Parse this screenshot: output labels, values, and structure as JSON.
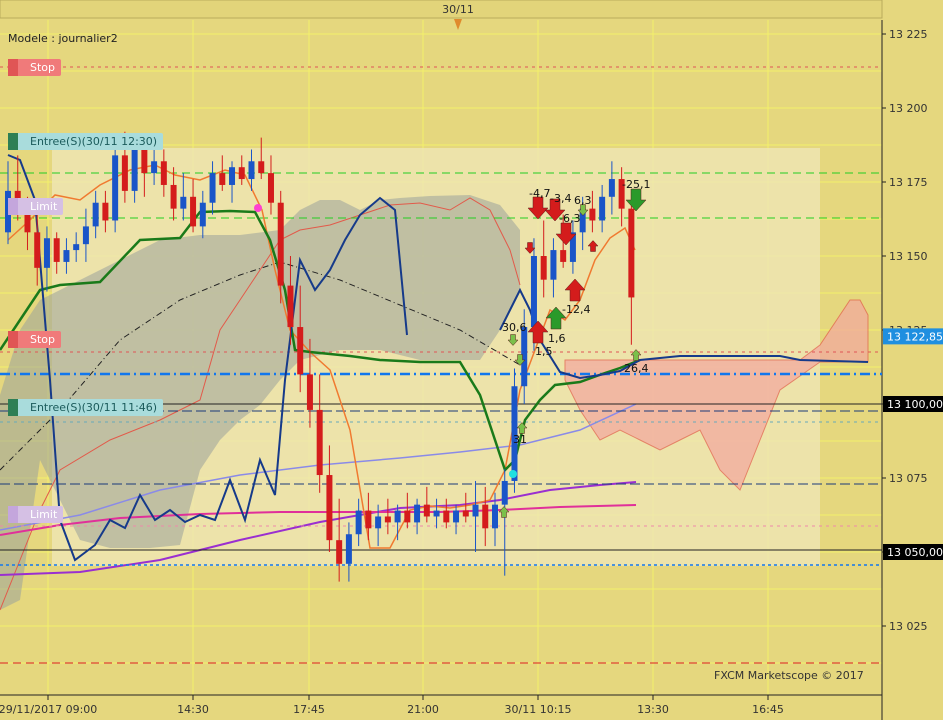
{
  "chart_data": {
    "type": "candlestick",
    "title": "Modele : journalier2",
    "watermark": "FXCM Marketscope © 2017",
    "top_date_label": "30/11",
    "ylim": [
      13010,
      13230
    ],
    "y_ticks": [
      "13 225",
      "13 200",
      "13 175",
      "13 150",
      "13 125",
      "13 100",
      "13 075",
      "13 050",
      "13 025"
    ],
    "x_ticks": [
      "29/11/2017 09:00",
      "14:30",
      "17:45",
      "21:00",
      "30/11 10:15",
      "13:30",
      "16:45"
    ],
    "price_boxes": [
      {
        "label": "13 122,85",
        "value": 13122.85,
        "style": "blue"
      },
      {
        "label": "13 100,00",
        "value": 13100.0,
        "style": "black"
      },
      {
        "label": "13 050,00",
        "value": 13050.0,
        "style": "black"
      }
    ],
    "order_tags": [
      {
        "label": "Stop",
        "kind": "stop",
        "value": 13214
      },
      {
        "label": "Entree(S)(30/11 12:30)",
        "kind": "entry",
        "value": 13189
      },
      {
        "label": "Limit",
        "kind": "limit",
        "value": 13167
      },
      {
        "label": "Stop",
        "kind": "stop",
        "value": 13122
      },
      {
        "label": "Entree(S)(30/11 11:46)",
        "kind": "entry",
        "value": 13099
      },
      {
        "label": "Limit",
        "kind": "limit",
        "value": 13063
      }
    ],
    "candles": [
      {
        "t": 0,
        "o": 13158,
        "h": 13182,
        "l": 13154,
        "c": 13172
      },
      {
        "t": 1,
        "o": 13172,
        "h": 13184,
        "l": 13162,
        "c": 13164
      },
      {
        "t": 2,
        "o": 13164,
        "h": 13170,
        "l": 13152,
        "c": 13158
      },
      {
        "t": 3,
        "o": 13158,
        "h": 13166,
        "l": 13140,
        "c": 13146
      },
      {
        "t": 4,
        "o": 13146,
        "h": 13160,
        "l": 13138,
        "c": 13156
      },
      {
        "t": 5,
        "o": 13156,
        "h": 13158,
        "l": 13144,
        "c": 13148
      },
      {
        "t": 6,
        "o": 13148,
        "h": 13156,
        "l": 13144,
        "c": 13152
      },
      {
        "t": 7,
        "o": 13152,
        "h": 13158,
        "l": 13148,
        "c": 13154
      },
      {
        "t": 8,
        "o": 13154,
        "h": 13166,
        "l": 13148,
        "c": 13160
      },
      {
        "t": 9,
        "o": 13160,
        "h": 13172,
        "l": 13156,
        "c": 13168
      },
      {
        "t": 10,
        "o": 13168,
        "h": 13172,
        "l": 13158,
        "c": 13162
      },
      {
        "t": 11,
        "o": 13162,
        "h": 13188,
        "l": 13158,
        "c": 13184
      },
      {
        "t": 12,
        "o": 13184,
        "h": 13192,
        "l": 13168,
        "c": 13172
      },
      {
        "t": 13,
        "o": 13172,
        "h": 13190,
        "l": 13168,
        "c": 13186
      },
      {
        "t": 14,
        "o": 13186,
        "h": 13188,
        "l": 13170,
        "c": 13178
      },
      {
        "t": 15,
        "o": 13178,
        "h": 13186,
        "l": 13174,
        "c": 13182
      },
      {
        "t": 16,
        "o": 13182,
        "h": 13186,
        "l": 13170,
        "c": 13174
      },
      {
        "t": 17,
        "o": 13174,
        "h": 13180,
        "l": 13162,
        "c": 13166
      },
      {
        "t": 18,
        "o": 13166,
        "h": 13178,
        "l": 13162,
        "c": 13170
      },
      {
        "t": 19,
        "o": 13170,
        "h": 13176,
        "l": 13158,
        "c": 13160
      },
      {
        "t": 20,
        "o": 13160,
        "h": 13172,
        "l": 13156,
        "c": 13168
      },
      {
        "t": 21,
        "o": 13168,
        "h": 13182,
        "l": 13164,
        "c": 13178
      },
      {
        "t": 22,
        "o": 13178,
        "h": 13184,
        "l": 13172,
        "c": 13174
      },
      {
        "t": 23,
        "o": 13174,
        "h": 13182,
        "l": 13168,
        "c": 13180
      },
      {
        "t": 24,
        "o": 13180,
        "h": 13184,
        "l": 13174,
        "c": 13176
      },
      {
        "t": 25,
        "o": 13176,
        "h": 13186,
        "l": 13172,
        "c": 13182
      },
      {
        "t": 26,
        "o": 13182,
        "h": 13190,
        "l": 13176,
        "c": 13178
      },
      {
        "t": 27,
        "o": 13178,
        "h": 13184,
        "l": 13164,
        "c": 13168
      },
      {
        "t": 28,
        "o": 13168,
        "h": 13172,
        "l": 13134,
        "c": 13140
      },
      {
        "t": 29,
        "o": 13140,
        "h": 13150,
        "l": 13120,
        "c": 13126
      },
      {
        "t": 30,
        "o": 13126,
        "h": 13140,
        "l": 13104,
        "c": 13110
      },
      {
        "t": 31,
        "o": 13110,
        "h": 13122,
        "l": 13092,
        "c": 13098
      },
      {
        "t": 32,
        "o": 13098,
        "h": 13110,
        "l": 13070,
        "c": 13076
      },
      {
        "t": 33,
        "o": 13076,
        "h": 13086,
        "l": 13050,
        "c": 13054
      },
      {
        "t": 34,
        "o": 13054,
        "h": 13068,
        "l": 13040,
        "c": 13046
      },
      {
        "t": 35,
        "o": 13046,
        "h": 13060,
        "l": 13040,
        "c": 13056
      },
      {
        "t": 36,
        "o": 13056,
        "h": 13068,
        "l": 13052,
        "c": 13064
      },
      {
        "t": 37,
        "o": 13064,
        "h": 13070,
        "l": 13054,
        "c": 13058
      },
      {
        "t": 38,
        "o": 13058,
        "h": 13066,
        "l": 13052,
        "c": 13062
      },
      {
        "t": 39,
        "o": 13062,
        "h": 13068,
        "l": 13056,
        "c": 13060
      },
      {
        "t": 40,
        "o": 13060,
        "h": 13066,
        "l": 13054,
        "c": 13064
      },
      {
        "t": 41,
        "o": 13064,
        "h": 13070,
        "l": 13058,
        "c": 13060
      },
      {
        "t": 42,
        "o": 13060,
        "h": 13068,
        "l": 13056,
        "c": 13066
      },
      {
        "t": 43,
        "o": 13066,
        "h": 13072,
        "l": 13060,
        "c": 13062
      },
      {
        "t": 44,
        "o": 13062,
        "h": 13068,
        "l": 13058,
        "c": 13064
      },
      {
        "t": 45,
        "o": 13064,
        "h": 13068,
        "l": 13058,
        "c": 13060
      },
      {
        "t": 46,
        "o": 13060,
        "h": 13066,
        "l": 13056,
        "c": 13064
      },
      {
        "t": 47,
        "o": 13064,
        "h": 13070,
        "l": 13060,
        "c": 13062
      },
      {
        "t": 48,
        "o": 13062,
        "h": 13074,
        "l": 13050,
        "c": 13066
      },
      {
        "t": 49,
        "o": 13066,
        "h": 13072,
        "l": 13052,
        "c": 13058
      },
      {
        "t": 50,
        "o": 13058,
        "h": 13070,
        "l": 13052,
        "c": 13066
      },
      {
        "t": 51,
        "o": 13066,
        "h": 13078,
        "l": 13042,
        "c": 13074
      },
      {
        "t": 52,
        "o": 13074,
        "h": 13112,
        "l": 13070,
        "c": 13106
      },
      {
        "t": 53,
        "o": 13106,
        "h": 13132,
        "l": 13100,
        "c": 13126
      },
      {
        "t": 54,
        "o": 13126,
        "h": 13156,
        "l": 13118,
        "c": 13150
      },
      {
        "t": 55,
        "o": 13150,
        "h": 13162,
        "l": 13136,
        "c": 13142
      },
      {
        "t": 56,
        "o": 13142,
        "h": 13156,
        "l": 13136,
        "c": 13152
      },
      {
        "t": 57,
        "o": 13152,
        "h": 13164,
        "l": 13146,
        "c": 13148
      },
      {
        "t": 58,
        "o": 13148,
        "h": 13162,
        "l": 13144,
        "c": 13158
      },
      {
        "t": 59,
        "o": 13158,
        "h": 13170,
        "l": 13152,
        "c": 13166
      },
      {
        "t": 60,
        "o": 13166,
        "h": 13172,
        "l": 13158,
        "c": 13162
      },
      {
        "t": 61,
        "o": 13162,
        "h": 13174,
        "l": 13158,
        "c": 13170
      },
      {
        "t": 62,
        "o": 13170,
        "h": 13182,
        "l": 13164,
        "c": 13176
      },
      {
        "t": 63,
        "o": 13176,
        "h": 13180,
        "l": 13160,
        "c": 13166
      },
      {
        "t": 64,
        "o": 13166,
        "h": 13168,
        "l": 13120,
        "c": 13136
      }
    ],
    "trade_labels": [
      "-4,7",
      "-3,4",
      "-6,3",
      "6,3",
      "-25,1",
      "30,6",
      "1,6",
      "-12,4",
      "1,5",
      "26,4",
      "31"
    ]
  }
}
